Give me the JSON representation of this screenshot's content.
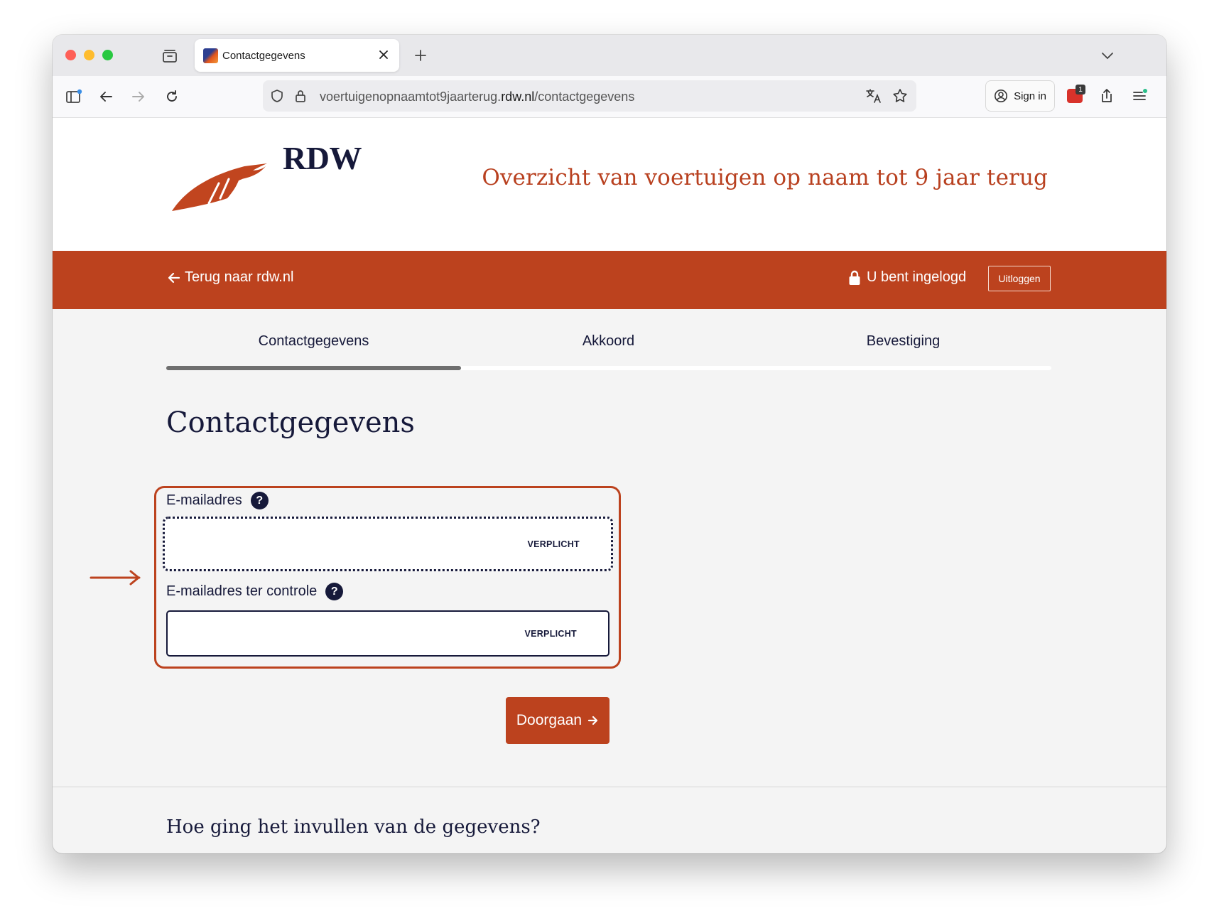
{
  "browser": {
    "tab_title": "Contactgegevens",
    "url_prefix": "voertuigenopnaamtot9jaarterug.",
    "url_host": "rdw.nl",
    "url_path": "/contactgegevens",
    "sign_in_label": "Sign in",
    "extension_badge": "1"
  },
  "header": {
    "logo_text": "RDW",
    "title": "Overzicht van voertuigen op naam tot 9 jaar terug"
  },
  "nav": {
    "back_label": "Terug naar rdw.nl",
    "login_status": "U bent ingelogd",
    "logout_label": "Uitloggen"
  },
  "steps": {
    "items": [
      {
        "label": "Contactgegevens",
        "active": true
      },
      {
        "label": "Akkoord",
        "active": false
      },
      {
        "label": "Bevestiging",
        "active": false
      }
    ],
    "progress": 0.333
  },
  "form": {
    "title": "Contactgegevens",
    "email": {
      "label": "E-mailadres",
      "value": "",
      "required_label": "VERPLICHT"
    },
    "email_confirm": {
      "label": "E-mailadres ter controle",
      "value": "",
      "required_label": "VERPLICHT"
    },
    "help_symbol": "?",
    "submit_label": "Doorgaan"
  },
  "feedback": {
    "title": "Hoe ging het invullen van de gegevens?"
  },
  "colors": {
    "brand": "#bc421e",
    "navy": "#16193a",
    "background": "#f4f4f4"
  }
}
